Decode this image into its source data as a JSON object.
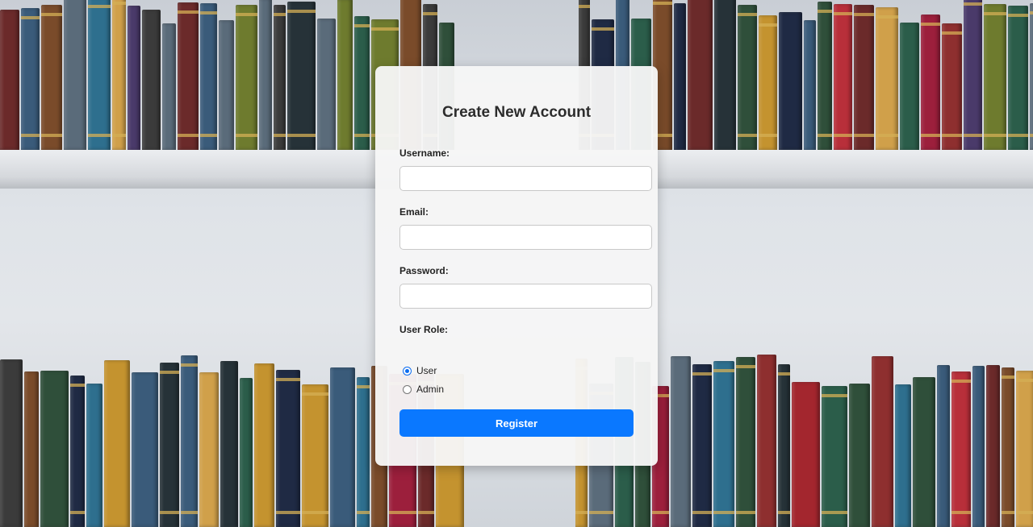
{
  "form": {
    "title": "Create New Account",
    "username_label": "Username:",
    "username_value": "",
    "email_label": "Email:",
    "email_value": "",
    "password_label": "Password:",
    "password_value": "",
    "role_label": "User Role:",
    "roles": [
      {
        "label": "User",
        "selected": true
      },
      {
        "label": "Admin",
        "selected": false
      }
    ],
    "register_label": "Register"
  },
  "colors": {
    "accent": "#0a78ff",
    "card_background": "#f6f6f6",
    "title_text": "#2c2c2c"
  }
}
